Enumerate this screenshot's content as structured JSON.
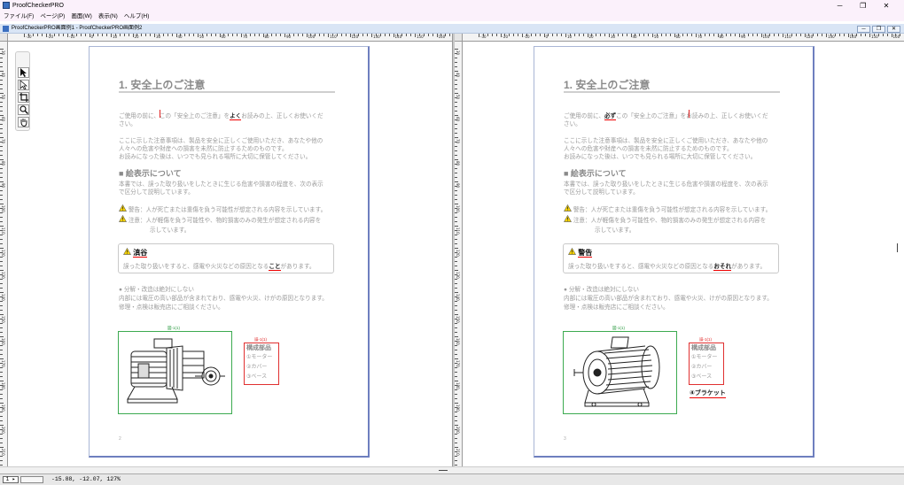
{
  "window": {
    "title": "ProofCheckerPRO",
    "controls": [
      "─",
      "❐",
      "✕"
    ]
  },
  "menu": [
    "ファイル(F)",
    "ページ(P)",
    "画面(W)",
    "表示(N)",
    "ヘルプ(H)"
  ],
  "document": {
    "title": "ProofCheckerPRO画面例1 - ProofCheckerPRO画面例2",
    "controls": [
      "─",
      "❐",
      "✕"
    ]
  },
  "ruler": {
    "h_labels": [
      "-30",
      "-20",
      "-10",
      "0",
      "10",
      "20",
      "30",
      "40",
      "50",
      "60",
      "70",
      "80",
      "90",
      "100",
      "110",
      "120",
      "130",
      "140",
      "150",
      "160"
    ],
    "v_labels": [
      "30",
      "40",
      "50",
      "60",
      "70",
      "80",
      "90",
      "100",
      "110",
      "120",
      "130",
      "140",
      "150",
      "160",
      "170",
      "180",
      "190",
      "200",
      "210"
    ]
  },
  "tools": [
    "select-arrow",
    "direct-select",
    "crop",
    "zoom",
    "hand"
  ],
  "pages": [
    {
      "heading": "1. 安全上のご注意",
      "intro": [
        "ご使用の前に、",
        "この「安全上のご注意」を",
        "よく",
        "お読みの上、正しくお使いくだ",
        "さい。"
      ],
      "para1": [
        "ここに示した注意事項は、製品を安全に正しくご使用いただき、あなたや他の",
        "人々への危害や財産への損害を未然に防止するためのものです。",
        "お読みになった後は、いつでも見られる場所に大切に保管してください。"
      ],
      "section_title": "■ 絵表示について",
      "section_body": [
        "本書では、誤った取り扱いをしたときに生じる危害や損害の程度を、次の表示",
        "で区分して説明しています。"
      ],
      "notice1": "警告：人が死亡または重傷を負う可能性が想定される内容を示しています。",
      "notice2": [
        "注意：人が軽傷を負う可能性や、物的損害のみの発生が想定される内容を",
        "示しています。"
      ],
      "box_title": "滇谷",
      "box_body": [
        "誤った取り扱いをすると、感電や火災などの原因となる",
        "こと",
        "があります。"
      ],
      "bullet": [
        "● 分解・改造は絶対にしない",
        "内部には電圧の高い部品が含まれており、感電や火災、けがの原因となります。",
        "修理・点検は販売店にご相談ください。"
      ],
      "image_marker": "図-1(1)",
      "part_marker": "誤-1(1)",
      "parts": [
        "構成部品",
        "①モーター",
        "②カバー",
        "③ベース"
      ],
      "page_number": "2"
    },
    {
      "heading": "1. 安全上のご注意",
      "intro": [
        "ご使用の前に、",
        "必ず",
        "この「安全上のご注意」を",
        "お読みの上、正しくお使いくだ",
        "さい。"
      ],
      "para1": [
        "ここに示した注意事項は、製品を安全に正しくご使用いただき、あなたや他の",
        "人々への危害や財産への損害を未然に防止するためのものです。",
        "お読みになった後は、いつでも見られる場所に大切に保管してください。"
      ],
      "section_title": "■ 絵表示について",
      "section_body": [
        "本書では、誤った取り扱いをしたときに生じる危害や損害の程度を、次の表示",
        "で区分して説明しています。"
      ],
      "notice1": "警告：人が死亡または重傷を負う可能性が想定される内容を示しています。",
      "notice2": [
        "注意：人が軽傷を負う可能性や、物的損害のみの発生が想定される内容を",
        "示しています。"
      ],
      "box_title": "警告",
      "box_body": [
        "誤った取り扱いをすると、感電や火災などの原因となる",
        "おそれ",
        "があります。"
      ],
      "bullet": [
        "● 分解・改造は絶対にしない",
        "内部には電圧の高い部品が含まれており、感電や火災、けがの原因となります。",
        "修理・点検は販売店にご相談ください。"
      ],
      "image_marker": "図-1(1)",
      "part_marker": "誤-1(1)",
      "parts": [
        "構成部品",
        "①モーター",
        "②カバー",
        "③ベース"
      ],
      "added_part": "④ブラケット",
      "page_number": "3"
    }
  ],
  "status": {
    "page_nav": "1 ▸",
    "coords": "-15.88, -12.07,  127%"
  },
  "colors": {
    "diff_green": "#3caa50",
    "diff_red": "#e03030",
    "page_border": "#6e7fbf"
  }
}
